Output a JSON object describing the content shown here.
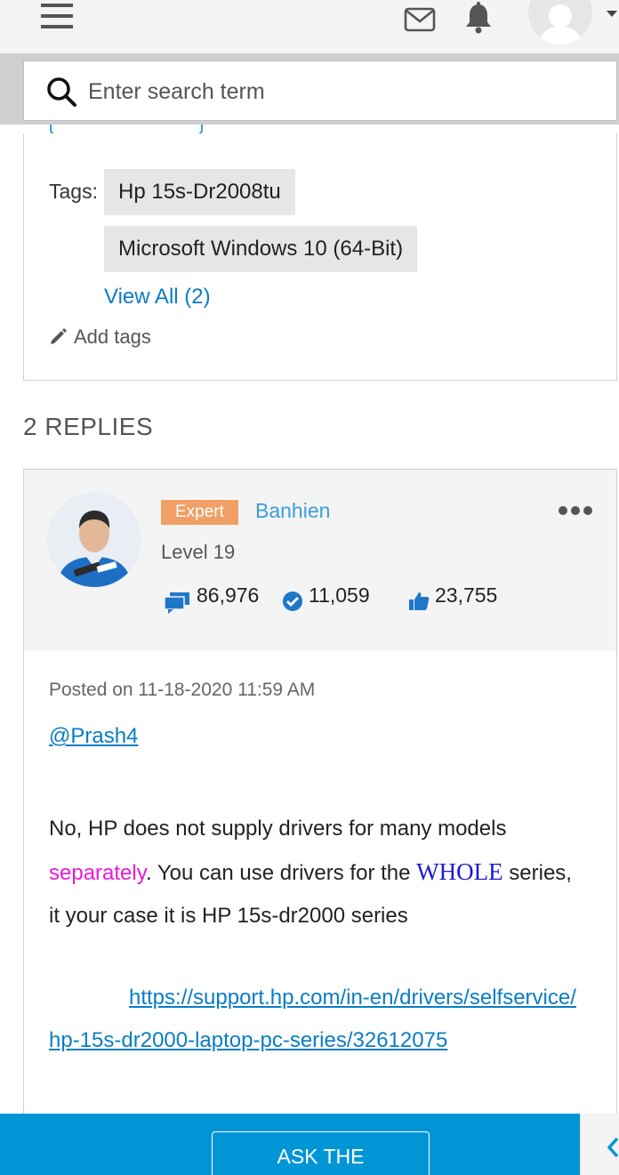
{
  "header": {
    "menu_icon": "hamburger-icon",
    "mail_icon": "mail-icon",
    "notifications_icon": "bell-icon",
    "avatar_icon": "user-avatar-icon"
  },
  "search": {
    "placeholder": "Enter search term",
    "value": ""
  },
  "tags_section": {
    "label": "Tags:",
    "tags": [
      "Hp 15s-Dr2008tu",
      "Microsoft Windows 10 (64-Bit)"
    ],
    "view_all": "View All (2)",
    "add_tags": "Add tags"
  },
  "replies": {
    "title": "2 REPLIES"
  },
  "reply": {
    "rank": "Expert",
    "author": "Banhien",
    "level": "Level 19",
    "messages": "86,976",
    "solutions": "11,059",
    "kudos": "23,755",
    "posted": "Posted on 11-18-2020 11:59 AM",
    "mention": "@Prash4",
    "body_part1": "No, HP does not supply drivers for many models ",
    "body_highlight1": "separately",
    "body_part2": ". You can use drivers for the ",
    "body_highlight2": "WHOLE",
    "body_part3": " series, it your case it is HP 15s-dr2000 series",
    "link": "https://support.hp.com/in-en/drivers/selfservice/hp-15s-dr2000-laptop-pc-series/32612075"
  },
  "footer": {
    "ask_button": "ASK THE COMMUNITY"
  },
  "colors": {
    "accent_blue": "#0096d6",
    "link_blue": "#0a7dc4",
    "expert_badge": "#f0a064",
    "magenta": "#e81ad6"
  }
}
